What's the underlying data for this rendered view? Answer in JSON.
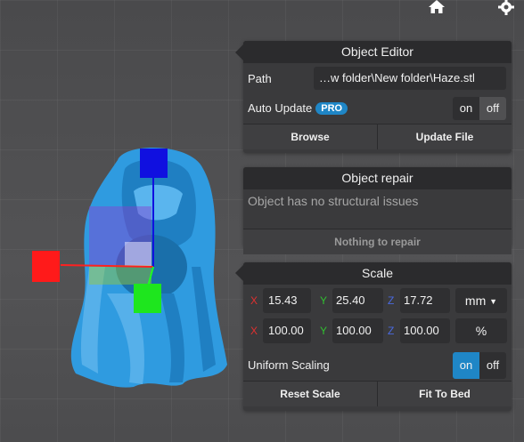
{
  "toolbar": {
    "home_icon": "home-icon",
    "settings_icon": "gear-icon"
  },
  "object_editor": {
    "title": "Object Editor",
    "path_label": "Path",
    "path_value": "…w folder\\New folder\\Haze.stl",
    "auto_update_label": "Auto Update",
    "pro_badge": "PRO",
    "toggle_on": "on",
    "toggle_off": "off",
    "browse": "Browse",
    "update_file": "Update File"
  },
  "object_repair": {
    "title": "Object repair",
    "message": "Object has no structural issues",
    "button": "Nothing to repair"
  },
  "scale": {
    "title": "Scale",
    "axis_x": "X",
    "axis_y": "Y",
    "axis_z": "Z",
    "size_x": "15.43",
    "size_y": "25.40",
    "size_z": "17.72",
    "unit": "mm",
    "pct_x": "100.00",
    "pct_y": "100.00",
    "pct_z": "100.00",
    "pct_unit": "%",
    "uniform_label": "Uniform Scaling",
    "toggle_on": "on",
    "toggle_off": "off",
    "reset": "Reset Scale",
    "fit": "Fit To Bed"
  },
  "colors": {
    "accent": "#1f86c6",
    "model": "#2f9be0",
    "x_axis": "#ff2020",
    "y_axis": "#20ff20",
    "z_axis": "#1010e0"
  }
}
